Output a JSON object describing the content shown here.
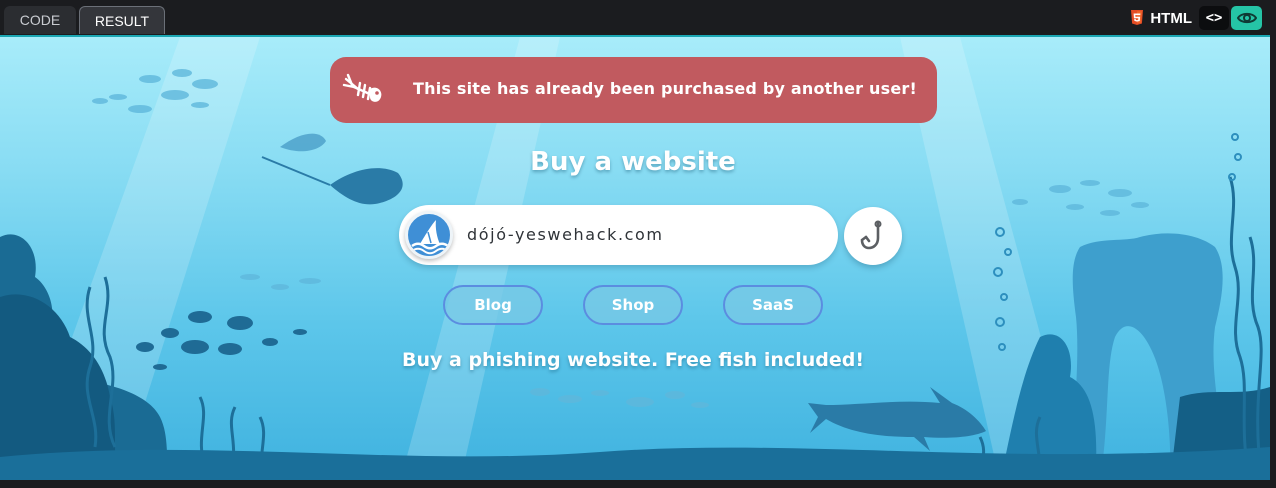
{
  "tabs": {
    "code": "CODE",
    "result": "RESULT"
  },
  "toolbar": {
    "language": "HTML",
    "code_toggle": "<>"
  },
  "alert": {
    "message": "This site has already been purchased by another user!"
  },
  "main": {
    "title": "Buy a website",
    "domain_value": "dójó-yeswehack.com",
    "tagline": "Buy a phishing website. Free fish included!"
  },
  "categories": [
    "Blog",
    "Shop",
    "SaaS"
  ],
  "colors": {
    "alert_bg": "#c15a5f",
    "water_top": "#a8ecfa",
    "water_bottom": "#3fb2df",
    "view_toggle": "#25c4a6",
    "pill_border": "#5b8de0"
  },
  "icons": [
    "html5-icon",
    "code-brackets-icon",
    "eye-icon",
    "fish-bone-icon",
    "shark-fin-icon",
    "fish-hook-icon"
  ]
}
